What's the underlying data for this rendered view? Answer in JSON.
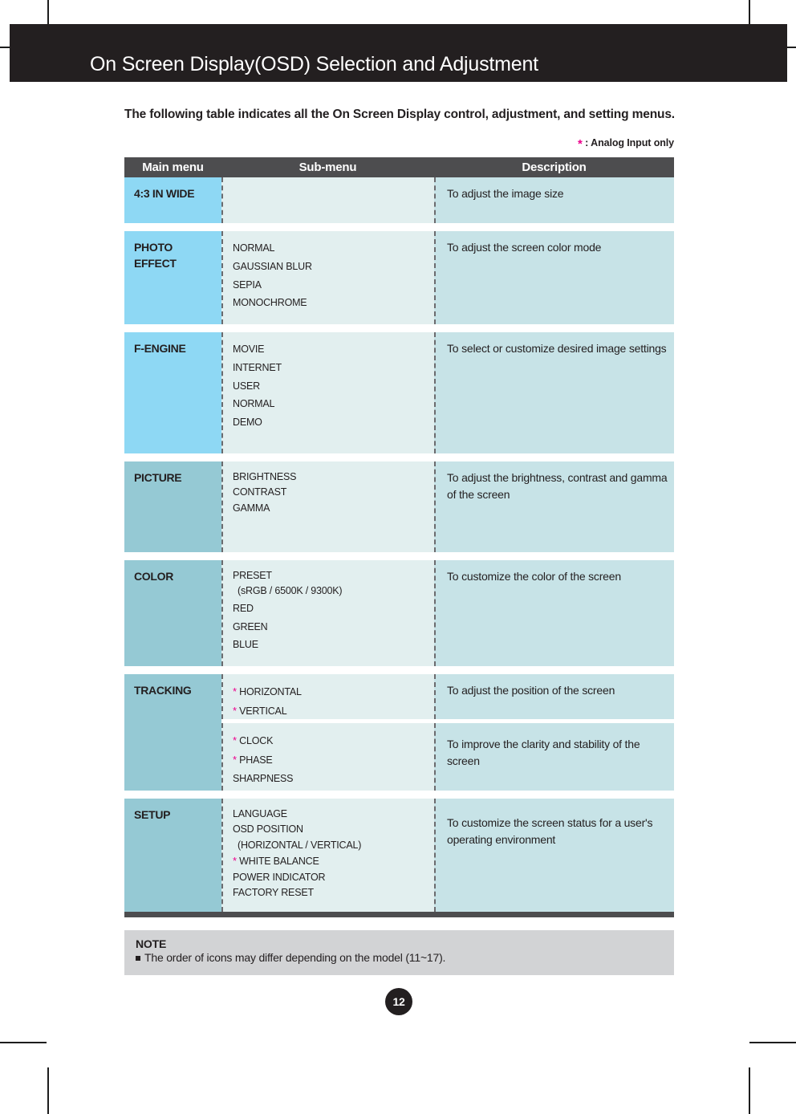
{
  "page": {
    "header_title": "On Screen Display(OSD) Selection and Adjustment",
    "intro": "The following table indicates all the On Screen Display control, adjustment, and setting menus.",
    "analog_marker": "*",
    "analog_note": ": Analog Input only",
    "page_number": "12",
    "accent_magenta": "#ec008c",
    "header_bg": "#231f20",
    "table_header_bg": "#4d4d4f",
    "main_menu_blue": "#8ed8f4",
    "main_menu_teal": "#95c9d4",
    "sub_menu_bg": "#e2efef",
    "description_bg": "#c7e3e7",
    "note_bg": "#d2d3d5"
  },
  "table": {
    "headers": {
      "main": "Main menu",
      "sub": "Sub-menu",
      "description": "Description"
    },
    "rows": [
      {
        "main": "4:3 IN WIDE",
        "main_tone": "blue",
        "sub": [],
        "description": "To adjust the image size"
      },
      {
        "main": "PHOTO\nEFFECT",
        "main_line1": "PHOTO",
        "main_line2": "EFFECT",
        "main_tone": "blue",
        "sub": [
          "NORMAL",
          "GAUSSIAN BLUR",
          "SEPIA",
          "MONOCHROME"
        ],
        "description": "To adjust the screen color mode"
      },
      {
        "main": "F-ENGINE",
        "main_tone": "blue",
        "sub": [
          "MOVIE",
          "INTERNET",
          "USER",
          "NORMAL",
          "DEMO"
        ],
        "description": "To select or customize desired image settings"
      },
      {
        "main": "PICTURE",
        "main_tone": "teal",
        "sub": [
          "BRIGHTNESS",
          "CONTRAST",
          "GAMMA"
        ],
        "description": "To adjust the brightness, contrast and gamma of the screen"
      },
      {
        "main": "COLOR",
        "main_tone": "teal",
        "sub": [
          "PRESET",
          "(sRGB / 6500K / 9300K)",
          "RED",
          "GREEN",
          "BLUE"
        ],
        "description": "To customize the color of the screen"
      },
      {
        "main": "TRACKING",
        "main_tone": "teal",
        "sub_groups": [
          {
            "sub": [
              "HORIZONTAL",
              "VERTICAL"
            ],
            "stars": [
              true,
              true
            ],
            "description": "To adjust the position of the screen"
          },
          {
            "sub": [
              "CLOCK",
              "PHASE",
              "SHARPNESS"
            ],
            "stars": [
              true,
              true,
              false
            ],
            "description": "To improve the clarity and stability of the screen"
          }
        ]
      },
      {
        "main": "SETUP",
        "main_tone": "teal",
        "sub": [
          "LANGUAGE",
          "OSD POSITION",
          "(HORIZONTAL / VERTICAL)",
          "WHITE BALANCE",
          "POWER INDICATOR",
          "FACTORY RESET"
        ],
        "stars": [
          false,
          false,
          false,
          true,
          false,
          false
        ],
        "description": "To customize the screen status for a user's operating environment"
      }
    ]
  },
  "note": {
    "title": "NOTE",
    "body": "The order of icons may differ depending on the model (11~17)."
  }
}
